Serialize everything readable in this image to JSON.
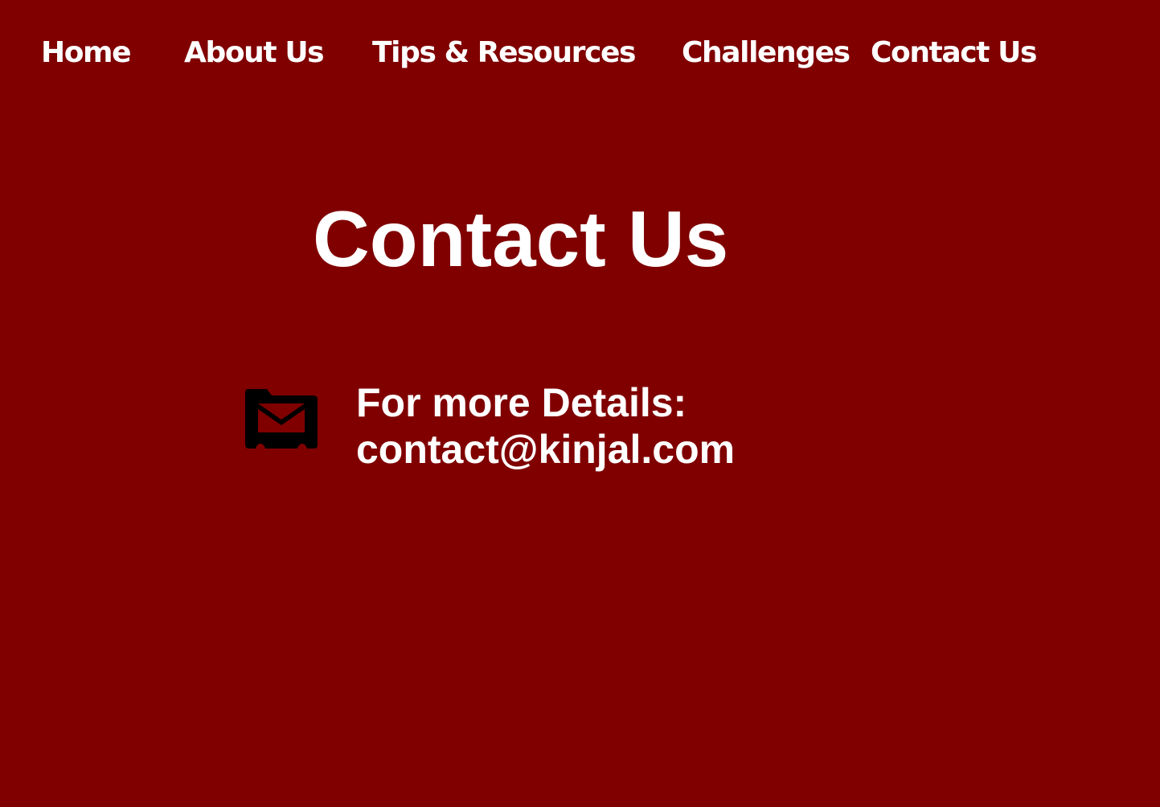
{
  "nav": {
    "items": [
      {
        "label": "Home"
      },
      {
        "label": "About Us"
      },
      {
        "label": "Tips & Resources"
      },
      {
        "label": "Challenges"
      },
      {
        "label": "Contact Us"
      }
    ]
  },
  "main": {
    "title": "Contact Us",
    "contact": {
      "icon": "mail-folder-icon",
      "label": "For more Details:",
      "email": "contact@kinjal.com"
    }
  },
  "colors": {
    "background": "#800000",
    "text": "#ffffff",
    "icon": "#000000"
  }
}
